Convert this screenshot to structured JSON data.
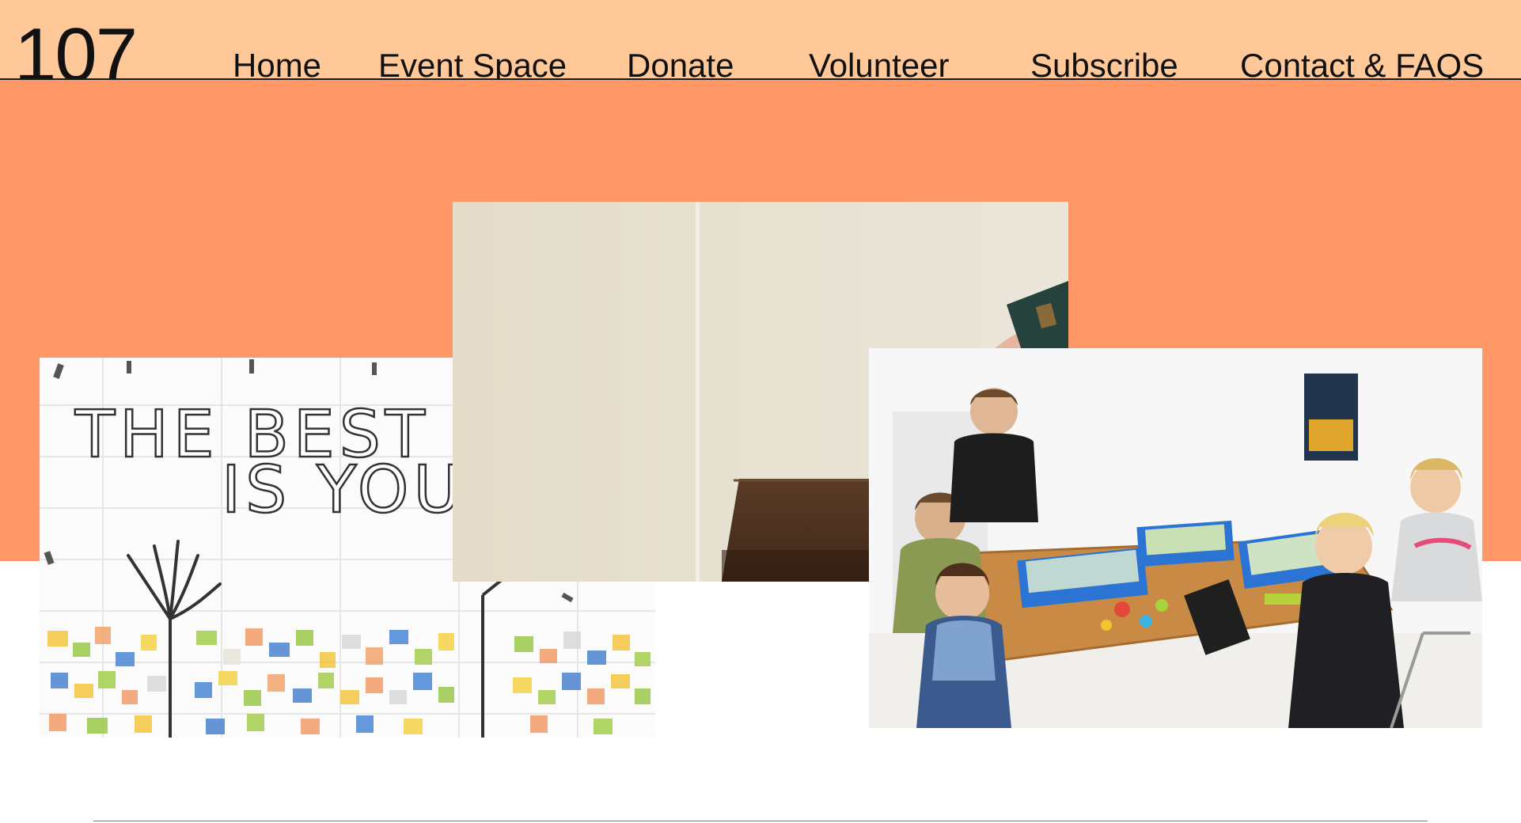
{
  "header": {
    "logo": "107",
    "nav": [
      {
        "label": "Home"
      },
      {
        "label": "Event Space"
      },
      {
        "label": "Donate"
      },
      {
        "label": "Volunteer"
      },
      {
        "label": "Subscribe"
      },
      {
        "label": "Contact & FAQS"
      }
    ]
  },
  "hero": {
    "photos": [
      {
        "subject": "mural",
        "text_lines": [
          "THE BEST",
          "IS YOU"
        ]
      },
      {
        "subject": "donation box"
      },
      {
        "subject": "children building robots"
      }
    ]
  },
  "colors": {
    "header_bg": "#fec898",
    "hero_bg": "#ff9766",
    "page_bg": "#ffffff",
    "text": "#111111"
  }
}
